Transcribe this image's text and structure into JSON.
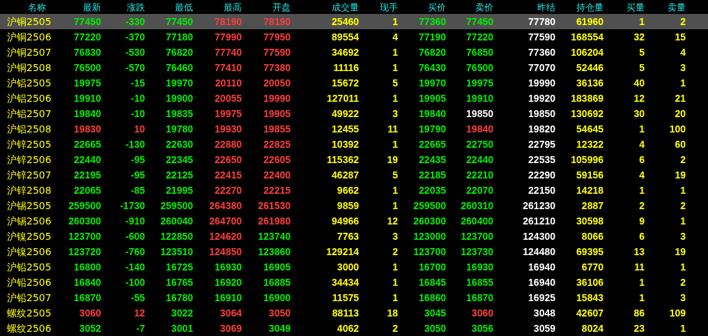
{
  "columns": [
    "名称",
    "最新",
    "涨跌",
    "最低",
    "最高",
    "开盘",
    "成交量",
    "现手",
    "买价",
    "卖价",
    "昨结",
    "持仓量",
    "买量",
    "卖量"
  ],
  "rows": [
    {
      "name": "沪铜2505",
      "selected": true,
      "cells": [
        {
          "text": "77450",
          "color": "#00ee00"
        },
        {
          "text": "-330",
          "color": "#00ee00"
        },
        {
          "text": "77450",
          "color": "#00ee00"
        },
        {
          "text": "78190",
          "color": "#ff3c3c"
        },
        {
          "text": "78190",
          "color": "#ff3c3c"
        },
        {
          "text": "25460",
          "color": "#ffff00"
        },
        {
          "text": "1",
          "color": "#ffff00"
        },
        {
          "text": "77360",
          "color": "#00ee00"
        },
        {
          "text": "77450",
          "color": "#00ee00"
        },
        {
          "text": "77780",
          "color": "#ffffff"
        },
        {
          "text": "61960",
          "color": "#ffff00"
        },
        {
          "text": "1",
          "color": "#ffff00"
        },
        {
          "text": "2",
          "color": "#ffff00"
        }
      ]
    },
    {
      "name": "沪铜2506",
      "selected": false,
      "cells": [
        {
          "text": "77220",
          "color": "#00ee00"
        },
        {
          "text": "-370",
          "color": "#00ee00"
        },
        {
          "text": "77180",
          "color": "#00ee00"
        },
        {
          "text": "77990",
          "color": "#ff3c3c"
        },
        {
          "text": "77950",
          "color": "#ff3c3c"
        },
        {
          "text": "89554",
          "color": "#ffff00"
        },
        {
          "text": "4",
          "color": "#ffff00"
        },
        {
          "text": "77190",
          "color": "#00ee00"
        },
        {
          "text": "77220",
          "color": "#00ee00"
        },
        {
          "text": "77590",
          "color": "#ffffff"
        },
        {
          "text": "168554",
          "color": "#ffff00"
        },
        {
          "text": "32",
          "color": "#ffff00"
        },
        {
          "text": "15",
          "color": "#ffff00"
        }
      ]
    },
    {
      "name": "沪铜2507",
      "selected": false,
      "cells": [
        {
          "text": "76830",
          "color": "#00ee00"
        },
        {
          "text": "-530",
          "color": "#00ee00"
        },
        {
          "text": "76820",
          "color": "#00ee00"
        },
        {
          "text": "77740",
          "color": "#ff3c3c"
        },
        {
          "text": "77590",
          "color": "#ff3c3c"
        },
        {
          "text": "34692",
          "color": "#ffff00"
        },
        {
          "text": "1",
          "color": "#ffff00"
        },
        {
          "text": "76820",
          "color": "#00ee00"
        },
        {
          "text": "76850",
          "color": "#00ee00"
        },
        {
          "text": "77360",
          "color": "#ffffff"
        },
        {
          "text": "106204",
          "color": "#ffff00"
        },
        {
          "text": "5",
          "color": "#ffff00"
        },
        {
          "text": "4",
          "color": "#ffff00"
        }
      ]
    },
    {
      "name": "沪铜2508",
      "selected": false,
      "cells": [
        {
          "text": "76500",
          "color": "#00ee00"
        },
        {
          "text": "-570",
          "color": "#00ee00"
        },
        {
          "text": "76460",
          "color": "#00ee00"
        },
        {
          "text": "77410",
          "color": "#ff3c3c"
        },
        {
          "text": "77380",
          "color": "#ff3c3c"
        },
        {
          "text": "11116",
          "color": "#ffff00"
        },
        {
          "text": "1",
          "color": "#ffff00"
        },
        {
          "text": "76430",
          "color": "#00ee00"
        },
        {
          "text": "76500",
          "color": "#00ee00"
        },
        {
          "text": "77070",
          "color": "#ffffff"
        },
        {
          "text": "52446",
          "color": "#ffff00"
        },
        {
          "text": "5",
          "color": "#ffff00"
        },
        {
          "text": "3",
          "color": "#ffff00"
        }
      ]
    },
    {
      "name": "沪铝2505",
      "selected": false,
      "cells": [
        {
          "text": "19975",
          "color": "#00ee00"
        },
        {
          "text": "-15",
          "color": "#00ee00"
        },
        {
          "text": "19970",
          "color": "#00ee00"
        },
        {
          "text": "20110",
          "color": "#ff3c3c"
        },
        {
          "text": "20050",
          "color": "#ff3c3c"
        },
        {
          "text": "15672",
          "color": "#ffff00"
        },
        {
          "text": "5",
          "color": "#ffff00"
        },
        {
          "text": "19970",
          "color": "#00ee00"
        },
        {
          "text": "19975",
          "color": "#00ee00"
        },
        {
          "text": "19990",
          "color": "#ffffff"
        },
        {
          "text": "36136",
          "color": "#ffff00"
        },
        {
          "text": "40",
          "color": "#ffff00"
        },
        {
          "text": "1",
          "color": "#ffff00"
        }
      ]
    },
    {
      "name": "沪铝2506",
      "selected": false,
      "cells": [
        {
          "text": "19910",
          "color": "#00ee00"
        },
        {
          "text": "-10",
          "color": "#00ee00"
        },
        {
          "text": "19900",
          "color": "#00ee00"
        },
        {
          "text": "20055",
          "color": "#ff3c3c"
        },
        {
          "text": "19990",
          "color": "#ff3c3c"
        },
        {
          "text": "127011",
          "color": "#ffff00"
        },
        {
          "text": "1",
          "color": "#ffff00"
        },
        {
          "text": "19905",
          "color": "#00ee00"
        },
        {
          "text": "19910",
          "color": "#00ee00"
        },
        {
          "text": "19920",
          "color": "#ffffff"
        },
        {
          "text": "183869",
          "color": "#ffff00"
        },
        {
          "text": "12",
          "color": "#ffff00"
        },
        {
          "text": "21",
          "color": "#ffff00"
        }
      ]
    },
    {
      "name": "沪铝2507",
      "selected": false,
      "cells": [
        {
          "text": "19840",
          "color": "#00ee00"
        },
        {
          "text": "-10",
          "color": "#00ee00"
        },
        {
          "text": "19835",
          "color": "#00ee00"
        },
        {
          "text": "19975",
          "color": "#ff3c3c"
        },
        {
          "text": "19905",
          "color": "#ff3c3c"
        },
        {
          "text": "49922",
          "color": "#ffff00"
        },
        {
          "text": "3",
          "color": "#ffff00"
        },
        {
          "text": "19840",
          "color": "#00ee00"
        },
        {
          "text": "19850",
          "color": "#ffffff"
        },
        {
          "text": "19850",
          "color": "#ffffff"
        },
        {
          "text": "130692",
          "color": "#ffff00"
        },
        {
          "text": "30",
          "color": "#ffff00"
        },
        {
          "text": "20",
          "color": "#ffff00"
        }
      ]
    },
    {
      "name": "沪铝2508",
      "selected": false,
      "cells": [
        {
          "text": "19830",
          "color": "#ff3c3c"
        },
        {
          "text": "10",
          "color": "#ff3c3c"
        },
        {
          "text": "19780",
          "color": "#00ee00"
        },
        {
          "text": "19930",
          "color": "#ff3c3c"
        },
        {
          "text": "19855",
          "color": "#ff3c3c"
        },
        {
          "text": "12455",
          "color": "#ffff00"
        },
        {
          "text": "11",
          "color": "#ffff00"
        },
        {
          "text": "19790",
          "color": "#00ee00"
        },
        {
          "text": "19840",
          "color": "#ff3c3c"
        },
        {
          "text": "19820",
          "color": "#ffffff"
        },
        {
          "text": "54645",
          "color": "#ffff00"
        },
        {
          "text": "1",
          "color": "#ffff00"
        },
        {
          "text": "100",
          "color": "#ffff00"
        }
      ]
    },
    {
      "name": "沪锌2505",
      "selected": false,
      "cells": [
        {
          "text": "22665",
          "color": "#00ee00"
        },
        {
          "text": "-130",
          "color": "#00ee00"
        },
        {
          "text": "22630",
          "color": "#00ee00"
        },
        {
          "text": "22880",
          "color": "#ff3c3c"
        },
        {
          "text": "22825",
          "color": "#ff3c3c"
        },
        {
          "text": "10392",
          "color": "#ffff00"
        },
        {
          "text": "1",
          "color": "#ffff00"
        },
        {
          "text": "22665",
          "color": "#00ee00"
        },
        {
          "text": "22750",
          "color": "#00ee00"
        },
        {
          "text": "22795",
          "color": "#ffffff"
        },
        {
          "text": "12322",
          "color": "#ffff00"
        },
        {
          "text": "4",
          "color": "#ffff00"
        },
        {
          "text": "60",
          "color": "#ffff00"
        }
      ]
    },
    {
      "name": "沪锌2506",
      "selected": false,
      "cells": [
        {
          "text": "22440",
          "color": "#00ee00"
        },
        {
          "text": "-95",
          "color": "#00ee00"
        },
        {
          "text": "22345",
          "color": "#00ee00"
        },
        {
          "text": "22650",
          "color": "#ff3c3c"
        },
        {
          "text": "22605",
          "color": "#ff3c3c"
        },
        {
          "text": "115362",
          "color": "#ffff00"
        },
        {
          "text": "19",
          "color": "#ffff00"
        },
        {
          "text": "22435",
          "color": "#00ee00"
        },
        {
          "text": "22440",
          "color": "#00ee00"
        },
        {
          "text": "22535",
          "color": "#ffffff"
        },
        {
          "text": "105996",
          "color": "#ffff00"
        },
        {
          "text": "6",
          "color": "#ffff00"
        },
        {
          "text": "2",
          "color": "#ffff00"
        }
      ]
    },
    {
      "name": "沪锌2507",
      "selected": false,
      "cells": [
        {
          "text": "22195",
          "color": "#00ee00"
        },
        {
          "text": "-95",
          "color": "#00ee00"
        },
        {
          "text": "22125",
          "color": "#00ee00"
        },
        {
          "text": "22415",
          "color": "#ff3c3c"
        },
        {
          "text": "22400",
          "color": "#ff3c3c"
        },
        {
          "text": "46287",
          "color": "#ffff00"
        },
        {
          "text": "5",
          "color": "#ffff00"
        },
        {
          "text": "22185",
          "color": "#00ee00"
        },
        {
          "text": "22210",
          "color": "#00ee00"
        },
        {
          "text": "22290",
          "color": "#ffffff"
        },
        {
          "text": "59156",
          "color": "#ffff00"
        },
        {
          "text": "4",
          "color": "#ffff00"
        },
        {
          "text": "19",
          "color": "#ffff00"
        }
      ]
    },
    {
      "name": "沪锌2508",
      "selected": false,
      "cells": [
        {
          "text": "22065",
          "color": "#00ee00"
        },
        {
          "text": "-85",
          "color": "#00ee00"
        },
        {
          "text": "21995",
          "color": "#00ee00"
        },
        {
          "text": "22270",
          "color": "#ff3c3c"
        },
        {
          "text": "22215",
          "color": "#ff3c3c"
        },
        {
          "text": "9662",
          "color": "#ffff00"
        },
        {
          "text": "1",
          "color": "#ffff00"
        },
        {
          "text": "22035",
          "color": "#00ee00"
        },
        {
          "text": "22070",
          "color": "#00ee00"
        },
        {
          "text": "22150",
          "color": "#ffffff"
        },
        {
          "text": "14218",
          "color": "#ffff00"
        },
        {
          "text": "1",
          "color": "#ffff00"
        },
        {
          "text": "1",
          "color": "#ffff00"
        }
      ]
    },
    {
      "name": "沪锡2505",
      "selected": false,
      "cells": [
        {
          "text": "259500",
          "color": "#00ee00"
        },
        {
          "text": "-1730",
          "color": "#00ee00"
        },
        {
          "text": "259500",
          "color": "#00ee00"
        },
        {
          "text": "264380",
          "color": "#ff3c3c"
        },
        {
          "text": "261530",
          "color": "#ff3c3c"
        },
        {
          "text": "9859",
          "color": "#ffff00"
        },
        {
          "text": "1",
          "color": "#ffff00"
        },
        {
          "text": "259500",
          "color": "#00ee00"
        },
        {
          "text": "260310",
          "color": "#00ee00"
        },
        {
          "text": "261230",
          "color": "#ffffff"
        },
        {
          "text": "2887",
          "color": "#ffff00"
        },
        {
          "text": "2",
          "color": "#ffff00"
        },
        {
          "text": "2",
          "color": "#ffff00"
        }
      ]
    },
    {
      "name": "沪锡2506",
      "selected": false,
      "cells": [
        {
          "text": "260300",
          "color": "#00ee00"
        },
        {
          "text": "-910",
          "color": "#00ee00"
        },
        {
          "text": "260040",
          "color": "#00ee00"
        },
        {
          "text": "264700",
          "color": "#ff3c3c"
        },
        {
          "text": "261980",
          "color": "#ff3c3c"
        },
        {
          "text": "94966",
          "color": "#ffff00"
        },
        {
          "text": "12",
          "color": "#ffff00"
        },
        {
          "text": "260300",
          "color": "#00ee00"
        },
        {
          "text": "260400",
          "color": "#00ee00"
        },
        {
          "text": "261210",
          "color": "#ffffff"
        },
        {
          "text": "30598",
          "color": "#ffff00"
        },
        {
          "text": "9",
          "color": "#ffff00"
        },
        {
          "text": "1",
          "color": "#ffff00"
        }
      ]
    },
    {
      "name": "沪镍2505",
      "selected": false,
      "cells": [
        {
          "text": "123700",
          "color": "#00ee00"
        },
        {
          "text": "-600",
          "color": "#00ee00"
        },
        {
          "text": "122850",
          "color": "#00ee00"
        },
        {
          "text": "124620",
          "color": "#ff3c3c"
        },
        {
          "text": "123740",
          "color": "#00ee00"
        },
        {
          "text": "7763",
          "color": "#ffff00"
        },
        {
          "text": "3",
          "color": "#ffff00"
        },
        {
          "text": "123000",
          "color": "#00ee00"
        },
        {
          "text": "123700",
          "color": "#00ee00"
        },
        {
          "text": "124300",
          "color": "#ffffff"
        },
        {
          "text": "8066",
          "color": "#ffff00"
        },
        {
          "text": "6",
          "color": "#ffff00"
        },
        {
          "text": "3",
          "color": "#ffff00"
        }
      ]
    },
    {
      "name": "沪镍2506",
      "selected": false,
      "cells": [
        {
          "text": "123720",
          "color": "#00ee00"
        },
        {
          "text": "-760",
          "color": "#00ee00"
        },
        {
          "text": "123510",
          "color": "#00ee00"
        },
        {
          "text": "124850",
          "color": "#ff3c3c"
        },
        {
          "text": "123860",
          "color": "#00ee00"
        },
        {
          "text": "129214",
          "color": "#ffff00"
        },
        {
          "text": "2",
          "color": "#ffff00"
        },
        {
          "text": "123700",
          "color": "#00ee00"
        },
        {
          "text": "123730",
          "color": "#00ee00"
        },
        {
          "text": "124480",
          "color": "#ffffff"
        },
        {
          "text": "69395",
          "color": "#ffff00"
        },
        {
          "text": "13",
          "color": "#ffff00"
        },
        {
          "text": "19",
          "color": "#ffff00"
        }
      ]
    },
    {
      "name": "沪铅2505",
      "selected": false,
      "cells": [
        {
          "text": "16800",
          "color": "#00ee00"
        },
        {
          "text": "-140",
          "color": "#00ee00"
        },
        {
          "text": "16725",
          "color": "#00ee00"
        },
        {
          "text": "16930",
          "color": "#00ee00"
        },
        {
          "text": "16905",
          "color": "#00ee00"
        },
        {
          "text": "3000",
          "color": "#ffff00"
        },
        {
          "text": "1",
          "color": "#ffff00"
        },
        {
          "text": "16700",
          "color": "#00ee00"
        },
        {
          "text": "16930",
          "color": "#00ee00"
        },
        {
          "text": "16940",
          "color": "#ffffff"
        },
        {
          "text": "6770",
          "color": "#ffff00"
        },
        {
          "text": "11",
          "color": "#ffff00"
        },
        {
          "text": "1",
          "color": "#ffff00"
        }
      ]
    },
    {
      "name": "沪铅2506",
      "selected": false,
      "cells": [
        {
          "text": "16840",
          "color": "#00ee00"
        },
        {
          "text": "-100",
          "color": "#00ee00"
        },
        {
          "text": "16765",
          "color": "#00ee00"
        },
        {
          "text": "16920",
          "color": "#00ee00"
        },
        {
          "text": "16885",
          "color": "#00ee00"
        },
        {
          "text": "34434",
          "color": "#ffff00"
        },
        {
          "text": "1",
          "color": "#ffff00"
        },
        {
          "text": "16845",
          "color": "#00ee00"
        },
        {
          "text": "16855",
          "color": "#00ee00"
        },
        {
          "text": "16940",
          "color": "#ffffff"
        },
        {
          "text": "36106",
          "color": "#ffff00"
        },
        {
          "text": "1",
          "color": "#ffff00"
        },
        {
          "text": "2",
          "color": "#ffff00"
        }
      ]
    },
    {
      "name": "沪铅2507",
      "selected": false,
      "cells": [
        {
          "text": "16870",
          "color": "#00ee00"
        },
        {
          "text": "-55",
          "color": "#00ee00"
        },
        {
          "text": "16780",
          "color": "#00ee00"
        },
        {
          "text": "16910",
          "color": "#00ee00"
        },
        {
          "text": "16900",
          "color": "#00ee00"
        },
        {
          "text": "11575",
          "color": "#ffff00"
        },
        {
          "text": "1",
          "color": "#ffff00"
        },
        {
          "text": "16860",
          "color": "#00ee00"
        },
        {
          "text": "16870",
          "color": "#00ee00"
        },
        {
          "text": "16925",
          "color": "#ffffff"
        },
        {
          "text": "15843",
          "color": "#ffff00"
        },
        {
          "text": "1",
          "color": "#ffff00"
        },
        {
          "text": "3",
          "color": "#ffff00"
        }
      ]
    },
    {
      "name": "螺纹2505",
      "selected": false,
      "cells": [
        {
          "text": "3060",
          "color": "#ff3c3c"
        },
        {
          "text": "12",
          "color": "#ff3c3c"
        },
        {
          "text": "3022",
          "color": "#00ee00"
        },
        {
          "text": "3064",
          "color": "#ff3c3c"
        },
        {
          "text": "3050",
          "color": "#ff3c3c"
        },
        {
          "text": "88113",
          "color": "#ffff00"
        },
        {
          "text": "18",
          "color": "#ffff00"
        },
        {
          "text": "3045",
          "color": "#00ee00"
        },
        {
          "text": "3060",
          "color": "#ff3c3c"
        },
        {
          "text": "3048",
          "color": "#ffffff"
        },
        {
          "text": "42607",
          "color": "#ffff00"
        },
        {
          "text": "86",
          "color": "#ffff00"
        },
        {
          "text": "109",
          "color": "#ffff00"
        }
      ]
    },
    {
      "name": "螺纹2506",
      "selected": false,
      "cells": [
        {
          "text": "3052",
          "color": "#00ee00"
        },
        {
          "text": "-7",
          "color": "#00ee00"
        },
        {
          "text": "3001",
          "color": "#00ee00"
        },
        {
          "text": "3069",
          "color": "#ff3c3c"
        },
        {
          "text": "3049",
          "color": "#00ee00"
        },
        {
          "text": "4062",
          "color": "#ffff00"
        },
        {
          "text": "2",
          "color": "#ffff00"
        },
        {
          "text": "3050",
          "color": "#00ee00"
        },
        {
          "text": "3056",
          "color": "#00ee00"
        },
        {
          "text": "3059",
          "color": "#ffffff"
        },
        {
          "text": "8024",
          "color": "#ffff00"
        },
        {
          "text": "23",
          "color": "#ffff00"
        },
        {
          "text": "1",
          "color": "#ffff00"
        }
      ]
    }
  ]
}
